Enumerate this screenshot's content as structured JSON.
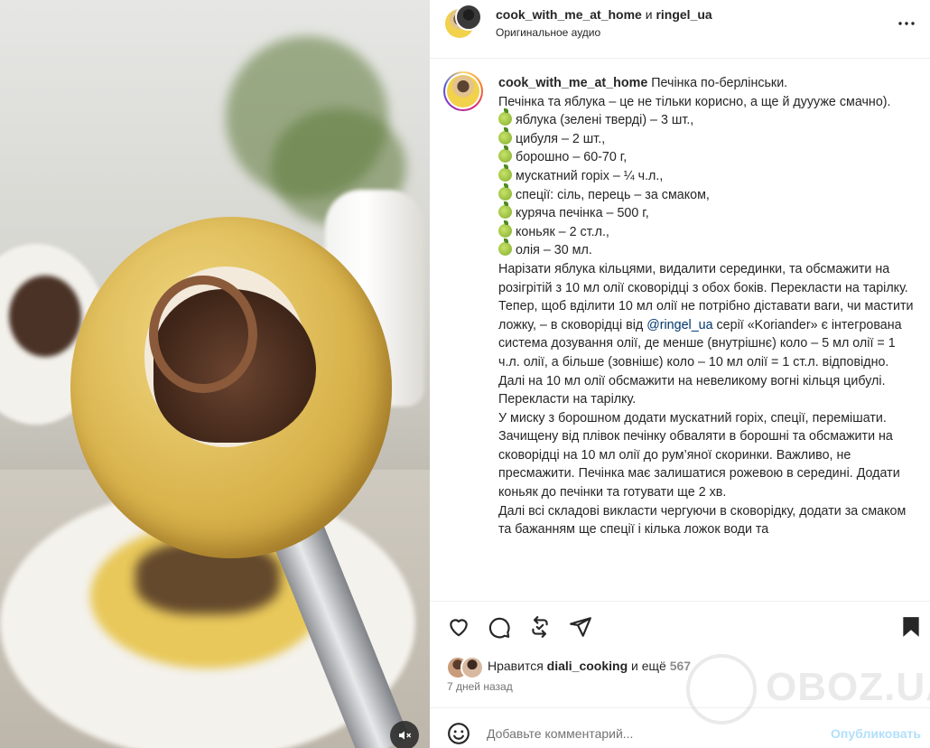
{
  "header": {
    "user1": "cook_with_me_at_home",
    "and_word": "и",
    "user2": "ringel_ua",
    "audio": "Оригинальное аудио"
  },
  "caption": {
    "username": "cook_with_me_at_home",
    "title": "Печінка по-берлінськи.",
    "intro": "Печінка та яблука – це не тільки корисно, а ще й дуууже смачно).",
    "ingredients": [
      "яблука (зелені тверді) – 3 шт.,",
      "цибуля – 2 шт.,",
      "борошно – 60-70 г,",
      "мускатний горіх – ¼ ч.л.,",
      "спеції: сіль, перець – за смаком,",
      "куряча печінка – 500 г,",
      "коньяк – 2 ст.л.,",
      "олія – 30 мл."
    ],
    "p1": "Нарізати яблука кільцями, видалити серединки, та обсмажити на розігрітій з 10 мл олії сковорідці з обох боків. Перекласти на тарілку.",
    "p2_before": "Тепер, щоб вділити 10 мл олії не потрібно діставати ваги, чи мастити ложку, – в сковорідці від ",
    "p2_mention": "@ringel_ua",
    "p2_after": " серії «Koriander» є інтегрована система дозування олії, де менше (внутрішнє) коло – 5 мл олії = 1 ч.л. олії, а більше (зовнішє) коло – 10 мл олії = 1 ст.л. відповідно.",
    "p3": "Далі на 10 мл олії обсмажити на невеликому вогні кільця цибулі. Перекласти на тарілку.",
    "p4": "У миску з борошном додати мускатний горіх, спеції, перемішати. Зачищену від плівок печінку обваляти в борошні та обсмажити на сковорідці на 10 мл олії до рум’яної скоринки. Важливо, не пресмажити. Печінка має залишатися рожевою в середині. Додати коньяк до печінки та готувати ще 2 хв.",
    "p5": "Далі всі складові викласти чергуючи в сковорідку, додати за смаком та бажанням ще спеції і кілька ложок води та"
  },
  "icons": {
    "more": "more-horizontal-icon",
    "like": "heart-icon",
    "comment": "comment-icon",
    "repost": "repost-icon",
    "share": "send-icon",
    "save": "bookmark-icon",
    "emoji": "emoji-icon",
    "mute": "speaker-muted-icon"
  },
  "likes": {
    "prefix": "Нравится",
    "user": "diali_cooking",
    "and_more": "и ещё",
    "count": "567"
  },
  "time": "7 дней назад",
  "comment": {
    "placeholder": "Добавьте комментарий...",
    "post_label": "Опубликовать"
  },
  "watermark": "OBOZ.UA",
  "colors": {
    "text": "#262626",
    "secondary": "#737373",
    "mention": "#00376b",
    "post_disabled": "#b2dffc",
    "divider": "#efefef"
  }
}
